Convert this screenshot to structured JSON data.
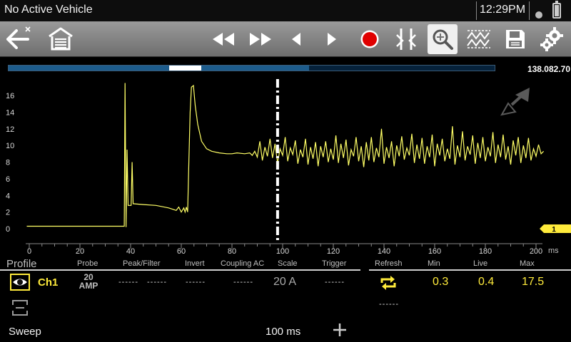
{
  "status_bar": {
    "title": "No Active Vehicle",
    "clock": "12:29PM"
  },
  "toolbar": {
    "buttons": [
      {
        "name": "back-button",
        "icon": "back-arrow-icon"
      },
      {
        "name": "home-button",
        "icon": "garage-icon"
      },
      {
        "name": "skip-back-button",
        "icon": "rewind-icon"
      },
      {
        "name": "skip-forward-button",
        "icon": "fast-forward-icon"
      },
      {
        "name": "step-back-button",
        "icon": "step-back-icon"
      },
      {
        "name": "step-forward-button",
        "icon": "step-forward-icon"
      },
      {
        "name": "record-button",
        "icon": "record-icon",
        "color": "#e00000"
      },
      {
        "name": "cursors-button",
        "icon": "cursors-icon"
      },
      {
        "name": "zoom-button",
        "icon": "zoom-icon",
        "active": true
      },
      {
        "name": "trace-button",
        "icon": "trace-icon"
      },
      {
        "name": "save-button",
        "icon": "floppy-disk-icon"
      },
      {
        "name": "settings-button",
        "icon": "gear-icon"
      }
    ]
  },
  "buffer": {
    "position_readout": "138.082.70",
    "seen_fraction": 0.618,
    "view_start": 0.33,
    "view_end": 0.397
  },
  "chart_data": {
    "type": "line",
    "xunit": "ms",
    "xlim": [
      0,
      200
    ],
    "ylim": [
      -1,
      17.5
    ],
    "x_ticks": [
      0,
      20,
      40,
      60,
      80,
      100,
      120,
      140,
      160,
      180,
      200
    ],
    "y_ticks": [
      0,
      2,
      4,
      6,
      8,
      10,
      12,
      14,
      16
    ],
    "cursor_x": 98,
    "trace_color": "#ffff66",
    "channel_marker": "1",
    "series": [
      {
        "points": [
          [
            -1,
            0.3
          ],
          [
            20,
            0.3
          ],
          [
            37.5,
            0.3
          ],
          [
            37.8,
            17.5
          ],
          [
            38.2,
            0.2
          ],
          [
            38.6,
            9.5
          ],
          [
            39,
            2.8
          ],
          [
            40.2,
            2.8
          ],
          [
            40.6,
            8
          ],
          [
            41,
            3
          ],
          [
            45,
            2.9
          ],
          [
            50,
            2.8
          ],
          [
            55,
            2.5
          ],
          [
            58,
            2.2
          ],
          [
            59,
            2.6
          ],
          [
            60,
            2
          ],
          [
            61,
            2.5
          ],
          [
            61.5,
            2
          ],
          [
            62,
            2.6
          ],
          [
            62.5,
            2
          ],
          [
            63,
            8
          ],
          [
            63.5,
            14
          ],
          [
            64,
            17
          ],
          [
            64.8,
            17.2
          ],
          [
            65.5,
            14.8
          ],
          [
            66.5,
            12.5
          ],
          [
            68,
            10.5
          ],
          [
            70,
            9.6
          ],
          [
            72,
            9.3
          ],
          [
            75,
            9.1
          ],
          [
            78,
            9.0
          ],
          [
            80,
            9.0
          ],
          [
            82,
            9.1
          ],
          [
            85,
            9.0
          ],
          [
            87,
            9.1
          ],
          [
            88,
            8.8
          ],
          [
            89,
            9.3
          ],
          [
            90,
            8.6
          ],
          [
            91,
            10.5
          ],
          [
            92,
            8.2
          ],
          [
            93,
            9.8
          ],
          [
            94,
            8.7
          ],
          [
            95,
            10.8
          ],
          [
            96,
            8.5
          ],
          [
            97,
            10.2
          ],
          [
            98,
            7.9
          ],
          [
            99,
            9.6
          ],
          [
            100,
            8.8
          ],
          [
            101,
            11.0
          ],
          [
            102,
            8.1
          ],
          [
            103,
            9.7
          ],
          [
            104,
            8.9
          ],
          [
            105,
            10.6
          ],
          [
            106,
            7.8
          ],
          [
            107,
            9.5
          ],
          [
            108,
            8.6
          ],
          [
            109,
            10.8
          ],
          [
            110,
            7.7
          ],
          [
            111,
            9.8
          ],
          [
            112,
            8.4
          ],
          [
            113,
            10.4
          ],
          [
            114,
            7.5
          ],
          [
            115,
            9.9
          ],
          [
            116,
            8.6
          ],
          [
            117,
            10.5
          ],
          [
            118,
            8.0
          ],
          [
            119,
            9.6
          ],
          [
            120,
            8.3
          ],
          [
            121,
            11.2
          ],
          [
            122,
            7.9
          ],
          [
            123,
            10.2
          ],
          [
            124,
            8.5
          ],
          [
            125,
            10.7
          ],
          [
            126,
            7.6
          ],
          [
            127,
            9.5
          ],
          [
            128,
            8.7
          ],
          [
            129,
            11.0
          ],
          [
            130,
            8.1
          ],
          [
            131,
            9.9
          ],
          [
            132,
            7.4
          ],
          [
            133,
            10.4
          ],
          [
            134,
            8.2
          ],
          [
            135,
            11.0
          ],
          [
            136,
            8.0
          ],
          [
            137,
            9.7
          ],
          [
            138,
            8.6
          ],
          [
            139,
            12.0
          ],
          [
            140,
            7.8
          ],
          [
            141,
            9.8
          ],
          [
            142,
            8.5
          ],
          [
            143,
            10.5
          ],
          [
            144,
            7.5
          ],
          [
            145,
            10.0
          ],
          [
            146,
            8.7
          ],
          [
            147,
            11.1
          ],
          [
            148,
            8.3
          ],
          [
            149,
            9.7
          ],
          [
            150,
            8.8
          ],
          [
            151,
            11.4
          ],
          [
            152,
            7.9
          ],
          [
            153,
            10.1
          ],
          [
            154,
            8.4
          ],
          [
            155,
            10.9
          ],
          [
            156,
            7.8
          ],
          [
            157,
            9.9
          ],
          [
            158,
            8.6
          ],
          [
            159,
            11.3
          ],
          [
            160,
            7.5
          ],
          [
            161,
            10.2
          ],
          [
            162,
            8.8
          ],
          [
            163,
            10.8
          ],
          [
            164,
            8.1
          ],
          [
            165,
            9.6
          ],
          [
            166,
            8.4
          ],
          [
            167,
            12.3
          ],
          [
            168,
            7.7
          ],
          [
            169,
            10.0
          ],
          [
            170,
            8.6
          ],
          [
            171,
            11.7
          ],
          [
            172,
            8.2
          ],
          [
            173,
            9.9
          ],
          [
            174,
            8.9
          ],
          [
            175,
            11.2
          ],
          [
            176,
            7.8
          ],
          [
            177,
            10.3
          ],
          [
            178,
            8.5
          ],
          [
            179,
            11.0
          ],
          [
            180,
            8.1
          ],
          [
            181,
            9.8
          ],
          [
            182,
            8.7
          ],
          [
            183,
            11.6
          ],
          [
            184,
            7.9
          ],
          [
            185,
            10.1
          ],
          [
            186,
            8.6
          ],
          [
            187,
            11.3
          ],
          [
            188,
            8.3
          ],
          [
            189,
            9.9
          ],
          [
            190,
            7.7
          ],
          [
            191,
            10.6
          ],
          [
            192,
            8.8
          ],
          [
            193,
            11.0
          ],
          [
            194,
            7.9
          ],
          [
            195,
            10.0
          ],
          [
            196,
            8.5
          ],
          [
            197,
            10.9
          ],
          [
            198,
            8.2
          ],
          [
            199,
            9.6
          ],
          [
            200,
            8.7
          ],
          [
            201,
            10.1
          ],
          [
            202,
            9.0
          ],
          [
            203,
            9.3
          ]
        ]
      }
    ]
  },
  "channel_panel": {
    "profile_label": "Profile",
    "headers": {
      "probe": "Probe",
      "peak_filter": "Peak/Filter",
      "invert": "Invert",
      "coupling": "Coupling AC",
      "scale": "Scale",
      "trigger": "Trigger",
      "refresh": "Refresh",
      "min": "Min",
      "live": "Live",
      "max": "Max"
    },
    "ch1": {
      "name": "Ch1",
      "probe_top": "20",
      "probe_bottom": "AMP",
      "peak": "------",
      "filter": "------",
      "invert": "------",
      "coupling": "------",
      "scale": "20 A",
      "trigger": "------",
      "min": "0.3",
      "live": "0.4",
      "max": "17.5"
    },
    "ch2_placeholder": "------",
    "accent_color": "#ffeb3b"
  },
  "sweep": {
    "label": "Sweep",
    "value": "100 ms"
  }
}
